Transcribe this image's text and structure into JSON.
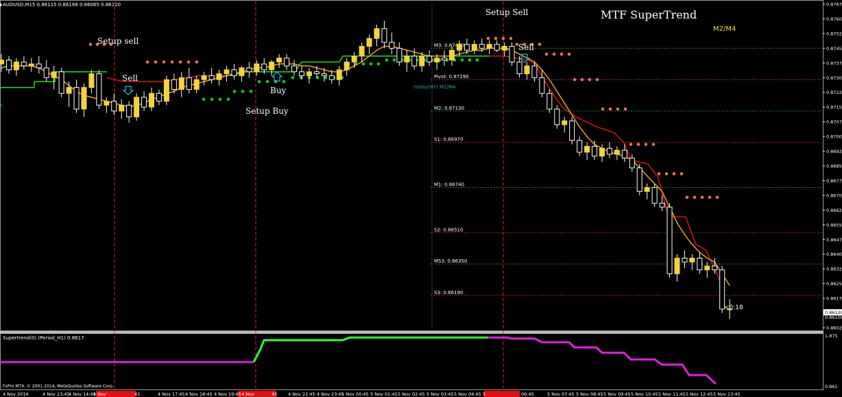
{
  "header": {
    "symbol_info": "AUDUSD,M15  0.86115 0.86166 0.86065 0.86120",
    "title": "MTF SuperTrend",
    "mode": "M2/M4"
  },
  "annotations": {
    "setup_sell_1": "Setup sell",
    "sell_1": "Sell",
    "buy_1": "Buy",
    "setup_buy": "Setup Buy",
    "setup_sell_2": "Setup Sell",
    "sell_2": "Sell",
    "today_label": "today(NY) M2/M4",
    "countdown": "<0:18",
    "current_price": "0.86120",
    "hidden_price": "0.86100"
  },
  "indicator": {
    "label": "Supertrend(0) (Period_H1) 0.8617",
    "scale_top": "1.875",
    "scale_bottom": "0.861"
  },
  "footer": {
    "copyright": "FxPro MT4, © 2001-2014, MetaQuotes Software Corp."
  },
  "levels": [
    {
      "label": "M3: 0.87450",
      "price": 0.8745,
      "color": "#1f8f1f"
    },
    {
      "label": "Pivot: 0.87290",
      "price": 0.8729,
      "color": "#b020b0"
    },
    {
      "label": "M2: 0.87130",
      "price": 0.8713,
      "color": "#1f8f1f"
    },
    {
      "label": "S1: 0.86970",
      "price": 0.8697,
      "color": "#b02020"
    },
    {
      "label": "M1: 0.86740",
      "price": 0.8674,
      "color": "#1f8f1f"
    },
    {
      "label": "S2: 0.86510",
      "price": 0.8651,
      "color": "#b02020"
    },
    {
      "label": "MS3: 0.86350",
      "price": 0.8635,
      "color": "#1f8f1f"
    },
    {
      "label": "S3: 0.86190",
      "price": 0.8619,
      "color": "#b02020"
    }
  ],
  "price_axis": [
    "0.87675",
    "0.87600",
    "0.87525",
    "0.87450",
    "0.87375",
    "0.87300",
    "0.87225",
    "0.87150",
    "0.87075",
    "0.87000",
    "0.86925",
    "0.86850",
    "0.86775",
    "0.86700",
    "0.86625",
    "0.86550",
    "0.86475",
    "0.86400",
    "0.86325",
    "0.86250",
    "0.86175",
    "0.86025"
  ],
  "time_axis": [
    "4 Nov 2014",
    "4 Nov 13:45",
    "4 Nov 14:45",
    "4 Nov",
    "45",
    "4 Nov 17:45",
    "4 Nov 18:45",
    "4 Nov 19:45",
    "4 Nov",
    "45",
    "4 Nov 22:45",
    "4 Nov 23:45",
    "5 Nov 00:45",
    "5 Nov 01:45",
    "5 Nov 02:45",
    "5 Nov 03:45",
    "5 Nov 04:45",
    "5",
    "06:45",
    "5 Nov 07:45",
    "5 Nov 08:45",
    "5 Nov 09:45",
    "5 Nov 10:45",
    "5 Nov 11:45",
    "5 Nov 12:45",
    "5 Nov 13:45"
  ],
  "colors": {
    "background": "#000000",
    "bull_candle": "#f5d33a",
    "bear_candle": "#ffffff",
    "ma_orange": "#f0a020",
    "supertrend_red": "#e01010",
    "supertrend_green": "#20e020",
    "dots_green": "#10d010",
    "dots_salmon": "#f07050",
    "indicator_green": "#30ff30",
    "indicator_magenta": "#e020e0",
    "separator_red": "#e02020"
  },
  "chart_data": {
    "type": "candlestick",
    "title": "MTF SuperTrend",
    "ylim": [
      0.86025,
      0.87675
    ],
    "candles": [
      [
        0.8737,
        0.8742,
        0.8733,
        0.8739
      ],
      [
        0.8739,
        0.8741,
        0.8732,
        0.8734
      ],
      [
        0.8734,
        0.874,
        0.8731,
        0.8738
      ],
      [
        0.8738,
        0.8741,
        0.8734,
        0.8736
      ],
      [
        0.8736,
        0.874,
        0.8733,
        0.8737
      ],
      [
        0.8737,
        0.8741,
        0.8732,
        0.8735
      ],
      [
        0.8735,
        0.8739,
        0.8728,
        0.873
      ],
      [
        0.873,
        0.8736,
        0.8724,
        0.8733
      ],
      [
        0.8733,
        0.8735,
        0.872,
        0.8722
      ],
      [
        0.8722,
        0.8728,
        0.8715,
        0.8725
      ],
      [
        0.8725,
        0.8729,
        0.8712,
        0.8714
      ],
      [
        0.8714,
        0.8727,
        0.871,
        0.8725
      ],
      [
        0.8725,
        0.8734,
        0.8722,
        0.8732
      ],
      [
        0.8732,
        0.8734,
        0.8714,
        0.8716
      ],
      [
        0.8716,
        0.872,
        0.8712,
        0.8718
      ],
      [
        0.8718,
        0.8722,
        0.8711,
        0.8713
      ],
      [
        0.8713,
        0.8719,
        0.8709,
        0.8716
      ],
      [
        0.8716,
        0.8718,
        0.8707,
        0.871
      ],
      [
        0.871,
        0.8722,
        0.8708,
        0.872
      ],
      [
        0.872,
        0.8723,
        0.8713,
        0.8715
      ],
      [
        0.8715,
        0.8725,
        0.8713,
        0.8722
      ],
      [
        0.8722,
        0.8724,
        0.8716,
        0.8718
      ],
      [
        0.8718,
        0.8731,
        0.8716,
        0.8729
      ],
      [
        0.8729,
        0.8732,
        0.8722,
        0.8724
      ],
      [
        0.8724,
        0.8733,
        0.872,
        0.873
      ],
      [
        0.873,
        0.8735,
        0.8722,
        0.8724
      ],
      [
        0.8724,
        0.8731,
        0.8722,
        0.8729
      ],
      [
        0.8729,
        0.8733,
        0.8726,
        0.8731
      ],
      [
        0.8731,
        0.8735,
        0.8727,
        0.8729
      ],
      [
        0.8729,
        0.8734,
        0.8726,
        0.8732
      ],
      [
        0.8732,
        0.8736,
        0.8728,
        0.8734
      ],
      [
        0.8734,
        0.8737,
        0.8729,
        0.8731
      ],
      [
        0.8731,
        0.8736,
        0.8728,
        0.8735
      ],
      [
        0.8735,
        0.8738,
        0.873,
        0.8733
      ],
      [
        0.8733,
        0.8739,
        0.8731,
        0.8737
      ],
      [
        0.8737,
        0.874,
        0.8732,
        0.8734
      ],
      [
        0.8734,
        0.8739,
        0.8731,
        0.8738
      ],
      [
        0.8738,
        0.8742,
        0.8735,
        0.874
      ],
      [
        0.874,
        0.8742,
        0.8734,
        0.8736
      ],
      [
        0.8736,
        0.8739,
        0.8731,
        0.8733
      ],
      [
        0.8733,
        0.8736,
        0.8729,
        0.8731
      ],
      [
        0.8731,
        0.8735,
        0.8727,
        0.8733
      ],
      [
        0.8733,
        0.8736,
        0.873,
        0.8732
      ],
      [
        0.8732,
        0.8735,
        0.8728,
        0.8731
      ],
      [
        0.8731,
        0.8734,
        0.8727,
        0.8729
      ],
      [
        0.8729,
        0.8736,
        0.8726,
        0.8734
      ],
      [
        0.8734,
        0.874,
        0.8731,
        0.8738
      ],
      [
        0.8738,
        0.8743,
        0.8735,
        0.8741
      ],
      [
        0.8741,
        0.8748,
        0.8738,
        0.8746
      ],
      [
        0.8746,
        0.8752,
        0.8742,
        0.875
      ],
      [
        0.875,
        0.8757,
        0.8746,
        0.8755
      ],
      [
        0.8755,
        0.8759,
        0.8745,
        0.8748
      ],
      [
        0.8748,
        0.8753,
        0.8742,
        0.8745
      ],
      [
        0.8745,
        0.8748,
        0.8736,
        0.8738
      ],
      [
        0.8738,
        0.8744,
        0.8733,
        0.8741
      ],
      [
        0.8741,
        0.8745,
        0.8734,
        0.8736
      ],
      [
        0.8736,
        0.8743,
        0.8733,
        0.8741
      ],
      [
        0.8741,
        0.8744,
        0.8736,
        0.8738
      ],
      [
        0.8738,
        0.8742,
        0.8734,
        0.874
      ],
      [
        0.874,
        0.8744,
        0.8736,
        0.8739
      ],
      [
        0.8739,
        0.8746,
        0.8736,
        0.8744
      ],
      [
        0.8744,
        0.8749,
        0.8741,
        0.8747
      ],
      [
        0.8747,
        0.875,
        0.8742,
        0.8744
      ],
      [
        0.8744,
        0.8749,
        0.8742,
        0.8747
      ],
      [
        0.8747,
        0.875,
        0.8743,
        0.8745
      ],
      [
        0.8745,
        0.8749,
        0.8742,
        0.8747
      ],
      [
        0.8747,
        0.8749,
        0.8743,
        0.8744
      ],
      [
        0.8744,
        0.8748,
        0.8741,
        0.8746
      ],
      [
        0.8746,
        0.8748,
        0.8736,
        0.8738
      ],
      [
        0.8738,
        0.8741,
        0.873,
        0.8732
      ],
      [
        0.8732,
        0.8738,
        0.8729,
        0.8736
      ],
      [
        0.8736,
        0.8738,
        0.8728,
        0.873
      ],
      [
        0.873,
        0.8734,
        0.872,
        0.8722
      ],
      [
        0.8722,
        0.8724,
        0.8712,
        0.8714
      ],
      [
        0.8714,
        0.8716,
        0.8704,
        0.8706
      ],
      [
        0.8706,
        0.871,
        0.8702,
        0.8708
      ],
      [
        0.8708,
        0.871,
        0.8696,
        0.8698
      ],
      [
        0.8698,
        0.87,
        0.869,
        0.8692
      ],
      [
        0.8692,
        0.8697,
        0.8688,
        0.8695
      ],
      [
        0.8695,
        0.8698,
        0.8688,
        0.869
      ],
      [
        0.869,
        0.8696,
        0.8687,
        0.8694
      ],
      [
        0.8694,
        0.8697,
        0.8689,
        0.8691
      ],
      [
        0.8691,
        0.8695,
        0.8688,
        0.8693
      ],
      [
        0.8693,
        0.8696,
        0.8687,
        0.8689
      ],
      [
        0.8689,
        0.8691,
        0.8682,
        0.8684
      ],
      [
        0.8684,
        0.8686,
        0.867,
        0.8672
      ],
      [
        0.8672,
        0.8676,
        0.8668,
        0.8674
      ],
      [
        0.8674,
        0.8676,
        0.8664,
        0.8666
      ],
      [
        0.8666,
        0.867,
        0.8662,
        0.8664
      ],
      [
        0.8664,
        0.8666,
        0.8628,
        0.863
      ],
      [
        0.863,
        0.864,
        0.8626,
        0.8638
      ],
      [
        0.8638,
        0.8642,
        0.8633,
        0.8636
      ],
      [
        0.8636,
        0.864,
        0.8632,
        0.8638
      ],
      [
        0.8638,
        0.8641,
        0.863,
        0.8632
      ],
      [
        0.8632,
        0.8636,
        0.8628,
        0.8634
      ],
      [
        0.8634,
        0.8638,
        0.863,
        0.8632
      ],
      [
        0.8632,
        0.8634,
        0.861,
        0.8612
      ],
      [
        0.8612,
        0.8617,
        0.8607,
        0.8612
      ]
    ],
    "series": [
      {
        "name": "",
        "values": [
          0.8735,
          0.8736,
          0.8736,
          0.8736,
          0.8736,
          0.8735,
          0.8733,
          0.8731,
          0.8729,
          0.8726,
          0.8723,
          0.8721,
          0.872,
          0.8719,
          0.8718,
          0.8717,
          0.8716,
          0.8715,
          0.8716,
          0.8717,
          0.8719,
          0.872,
          0.8722,
          0.8723,
          0.8725,
          0.8726,
          0.8727,
          0.8728,
          0.8729,
          0.873,
          0.8731,
          0.8732,
          0.8733,
          0.8734,
          0.8735,
          0.8735,
          0.8736,
          0.8737,
          0.8737,
          0.8737,
          0.8736,
          0.8736,
          0.8735,
          0.8734,
          0.8733,
          0.8733,
          0.8734,
          0.8736,
          0.8738,
          0.8741,
          0.8744,
          0.8746,
          0.8746,
          0.8745,
          0.8744,
          0.8743,
          0.8742,
          0.8741,
          0.8741,
          0.8741,
          0.8741,
          0.8742,
          0.8743,
          0.8744,
          0.8744,
          0.8745,
          0.8745,
          0.8745,
          0.8744,
          0.8742,
          0.874,
          0.8738,
          0.8734,
          0.8729,
          0.8723,
          0.8717,
          0.8711,
          0.8705,
          0.87,
          0.8696,
          0.8694,
          0.8692,
          0.8691,
          0.869,
          0.8688,
          0.8684,
          0.868,
          0.8676,
          0.8672,
          0.8664,
          0.8656,
          0.865,
          0.8645,
          0.8641,
          0.8638,
          0.8636,
          0.863,
          0.8624
        ]
      }
    ]
  }
}
